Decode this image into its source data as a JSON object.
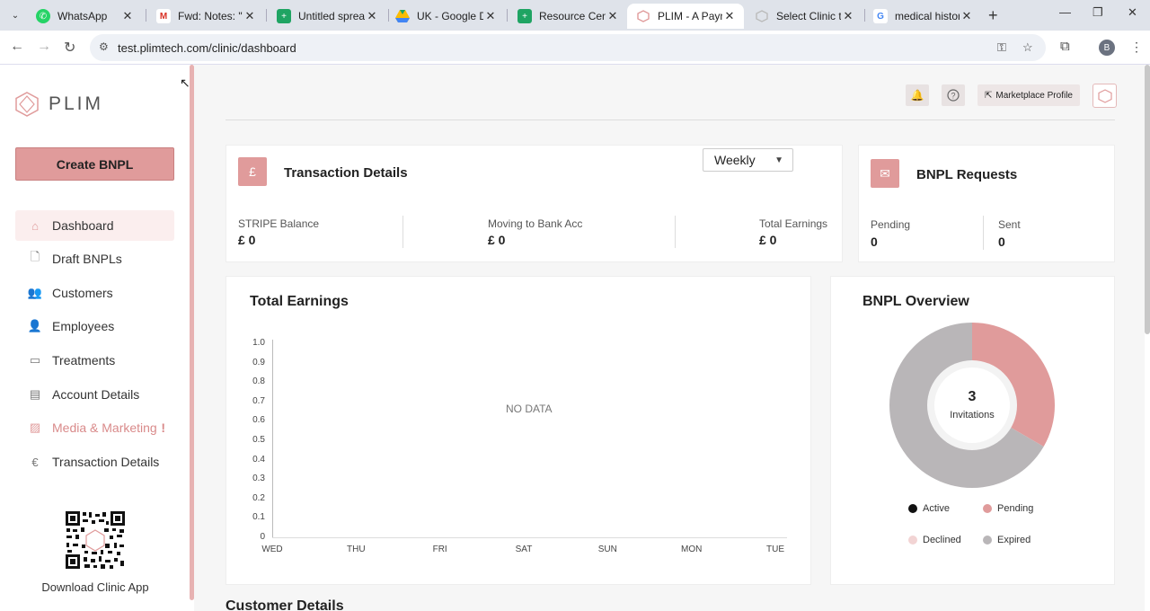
{
  "browser": {
    "tabs": [
      {
        "label": "WhatsApp",
        "icon": "whatsapp-icon"
      },
      {
        "label": "Fwd: Notes: \"Re",
        "icon": "gmail-icon"
      },
      {
        "label": "Untitled spreads",
        "icon": "sheets-icon"
      },
      {
        "label": "UK - Google Driv",
        "icon": "drive-icon"
      },
      {
        "label": "Resource Centre",
        "icon": "sheets-icon"
      },
      {
        "label": "PLIM - A Paymen",
        "icon": "plim-icon",
        "active": true
      },
      {
        "label": "Select Clinic to c",
        "icon": "loading-icon"
      },
      {
        "label": "medical history c",
        "icon": "google-icon"
      }
    ],
    "url": "test.plimtech.com/clinic/dashboard",
    "profile_initial": "B"
  },
  "sidebar": {
    "logo_text": "PLIM",
    "create_button": "Create BNPL",
    "items": [
      {
        "label": "Dashboard",
        "icon": "home-icon",
        "active": true
      },
      {
        "label": "Draft BNPLs",
        "icon": "document-icon"
      },
      {
        "label": "Customers",
        "icon": "users-icon"
      },
      {
        "label": "Employees",
        "icon": "user-add-icon"
      },
      {
        "label": "Treatments",
        "icon": "treatments-icon"
      },
      {
        "label": "Account Details",
        "icon": "id-card-icon"
      },
      {
        "label": "Media & Marketing",
        "icon": "image-icon",
        "badge": "!"
      },
      {
        "label": "Transaction Details",
        "icon": "pound-icon"
      }
    ],
    "download_label": "Download Clinic App"
  },
  "header": {
    "marketplace_label": "Marketplace Profile"
  },
  "transaction_details": {
    "title": "Transaction Details",
    "stats": [
      {
        "label": "STRIPE Balance",
        "value": "£ 0"
      },
      {
        "label": "Moving to Bank Acc",
        "value": "£ 0"
      },
      {
        "label": "Total Earnings",
        "value": "£ 0"
      }
    ]
  },
  "bnpl_requests": {
    "title": "BNPL Requests",
    "stats": [
      {
        "label": "Pending",
        "value": "0"
      },
      {
        "label": "Sent",
        "value": "0"
      }
    ]
  },
  "total_earnings": {
    "title": "Total Earnings",
    "period": "Weekly",
    "no_data": "NO DATA"
  },
  "bnpl_overview": {
    "title": "BNPL Overview",
    "center_value": "3",
    "center_label": "Invitations",
    "legend": [
      {
        "label": "Active",
        "color": "#111111"
      },
      {
        "label": "Pending",
        "color": "#e09b9b"
      },
      {
        "label": "Declined",
        "color": "#f2d4d4"
      },
      {
        "label": "Expired",
        "color": "#b9b6b8"
      }
    ]
  },
  "customer_details_heading": "Customer Details",
  "chart_data": [
    {
      "type": "line",
      "title": "Total Earnings",
      "categories": [
        "WED",
        "THU",
        "FRI",
        "SAT",
        "SUN",
        "MON",
        "TUE"
      ],
      "yticks": [
        "0",
        "0.1",
        "0.2",
        "0.3",
        "0.4",
        "0.5",
        "0.6",
        "0.7",
        "0.8",
        "0.9",
        "1.0"
      ],
      "ylim": [
        0,
        1.0
      ],
      "series": [],
      "annotation": "NO DATA"
    },
    {
      "type": "pie",
      "title": "BNPL Overview",
      "labels": [
        "Active",
        "Pending",
        "Declined",
        "Expired"
      ],
      "values": [
        0,
        1,
        0,
        2
      ],
      "colors": [
        "#111111",
        "#e09b9b",
        "#f2d4d4",
        "#b9b6b8"
      ]
    }
  ]
}
